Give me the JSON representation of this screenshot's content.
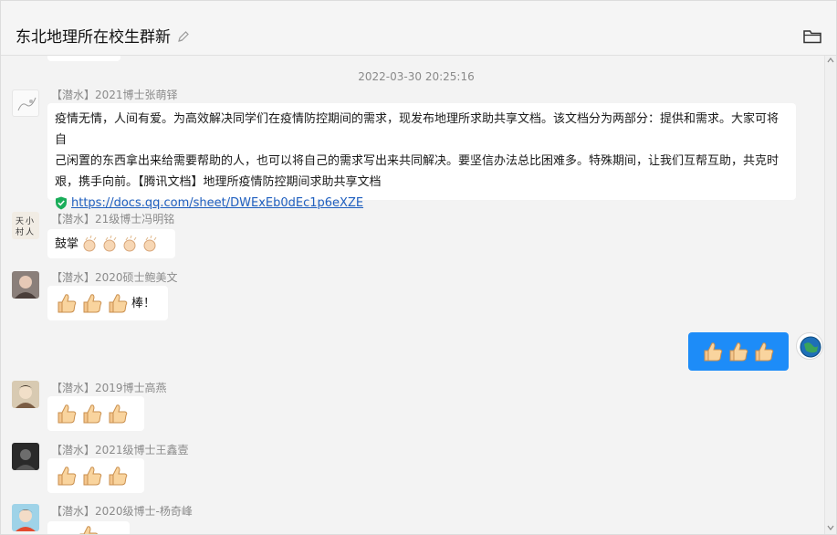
{
  "window": {
    "title": "东北地理所在校生群新",
    "icons": {
      "edit": "pencil-icon",
      "folder": "folder-icon"
    }
  },
  "chat": {
    "timestamp": "2022-03-30 20:25:16",
    "messages": [
      {
        "sender": "【潜水】2021博士张萌铎",
        "lines": [
          "疫情无情，人间有爱。为高效解决同学们在疫情防控期间的需求，现发布地理所求助共享文档。该文档分为两部分：提供和需求。大家可将自",
          "己闲置的东西拿出来给需要帮助的人，也可以将自己的需求写出来共同解决。要坚信办法总比困难多。特殊期间，让我们互帮互助，共克时",
          "艰，携手向前。【腾讯文档】地理所疫情防控期间求助共享文档"
        ],
        "link": "https://docs.qq.com/sheet/DWExEb0dEc1p6eXZE"
      },
      {
        "sender": "【潜水】21级博士冯明铭",
        "text": "鼓掌"
      },
      {
        "sender": "【潜水】2020硕士鲍美文",
        "text": "棒！"
      },
      {
        "sender": "【潜水】2019博士高燕"
      },
      {
        "sender": "【潜水】2021级博士王鑫壹"
      },
      {
        "sender": "【潜水】2020级博士-杨奇峰"
      }
    ]
  },
  "colors": {
    "self_bubble": "#1d8cf8",
    "link": "#1f5fbf"
  }
}
